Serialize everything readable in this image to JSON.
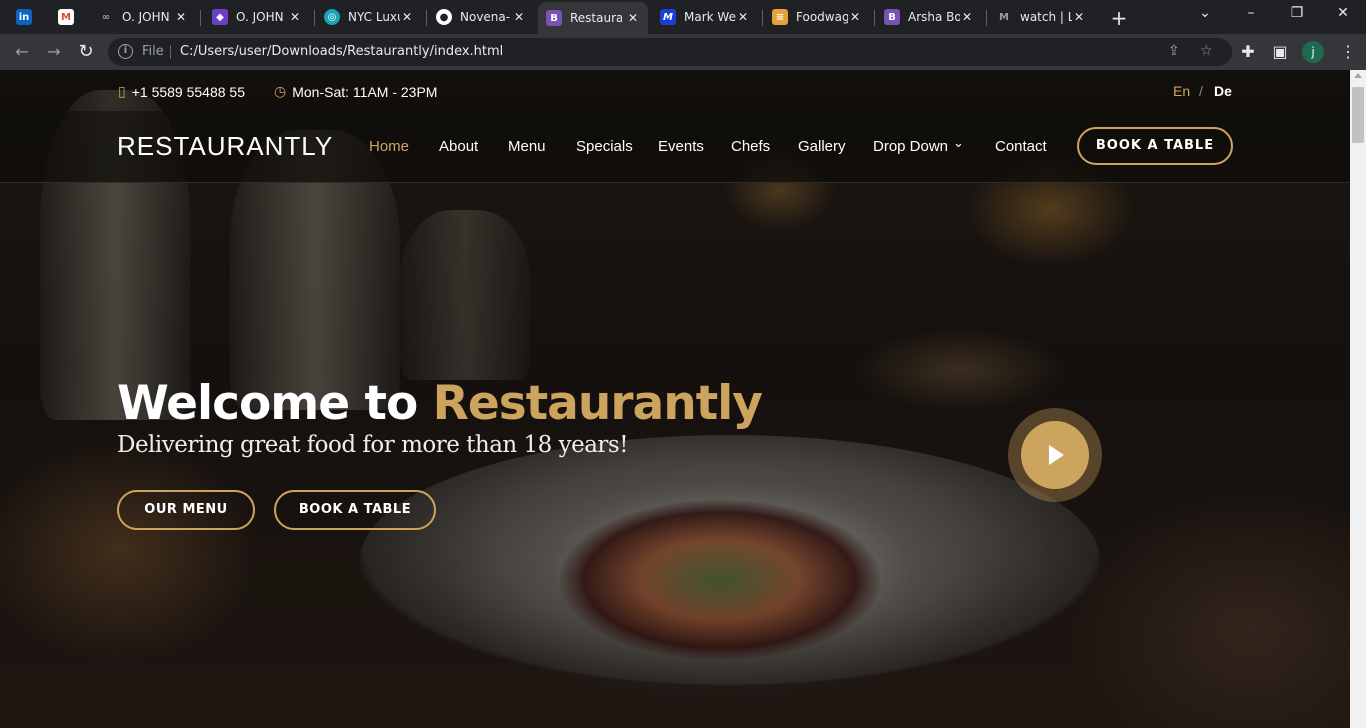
{
  "browser": {
    "tabs": [
      {
        "title": "",
        "favicon": "linkedin-icon",
        "color": "#0a66c2",
        "glyph": "in"
      },
      {
        "title": "",
        "favicon": "gmail-icon",
        "color": "#ea4335",
        "glyph": "M"
      },
      {
        "title": "O. JOHN",
        "favicon": "meta-icon",
        "color": "#3c4043",
        "glyph": "∞"
      },
      {
        "title": "O. JOHN",
        "favicon": "app-icon",
        "color": "#6d3fc4",
        "glyph": "◆"
      },
      {
        "title": "NYC Luxu",
        "favicon": "globe-icon",
        "color": "#1aa2b5",
        "glyph": "◎"
      },
      {
        "title": "Novena-",
        "favicon": "globe-icon",
        "color": "#5f6368",
        "glyph": "●"
      },
      {
        "title": "Restauran",
        "favicon": "bootstrap-icon",
        "color": "#7952b3",
        "glyph": "B"
      },
      {
        "title": "Mark We",
        "favicon": "m-icon",
        "color": "#1a3fd6",
        "glyph": "M"
      },
      {
        "title": "Foodwag",
        "favicon": "burger-icon",
        "color": "#e8a23a",
        "glyph": "≡"
      },
      {
        "title": "Arsha Bo",
        "favicon": "bootstrap-icon",
        "color": "#7952b3",
        "glyph": "B"
      },
      {
        "title": "watch | L",
        "favicon": "m-logo-icon",
        "color": "#3c4043",
        "glyph": "M"
      }
    ],
    "active_tab_index": 6,
    "url_scheme": "File",
    "url": "C:/Users/user/Downloads/Restaurantly/index.html",
    "profile_initial": "j"
  },
  "topbar": {
    "phone": "+1 5589 55488 55",
    "hours": "Mon-Sat: 11AM - 23PM",
    "lang_en": "En",
    "lang_sep": "/",
    "lang_de": "De"
  },
  "header": {
    "logo": "RESTAURANTLY",
    "nav": [
      "Home",
      "About",
      "Menu",
      "Specials",
      "Events",
      "Chefs",
      "Gallery",
      "Drop Down",
      "Contact"
    ],
    "book_button": "BOOK A TABLE"
  },
  "hero": {
    "title_prefix": "Welcome to",
    "title_brand": "Restaurantly",
    "subtitle": "Delivering great food for more than 18 years!",
    "menu_button": "OUR MENU",
    "book_button": "BOOK A TABLE"
  },
  "colors": {
    "accent": "#cda45e",
    "browser_bg": "#202124"
  }
}
